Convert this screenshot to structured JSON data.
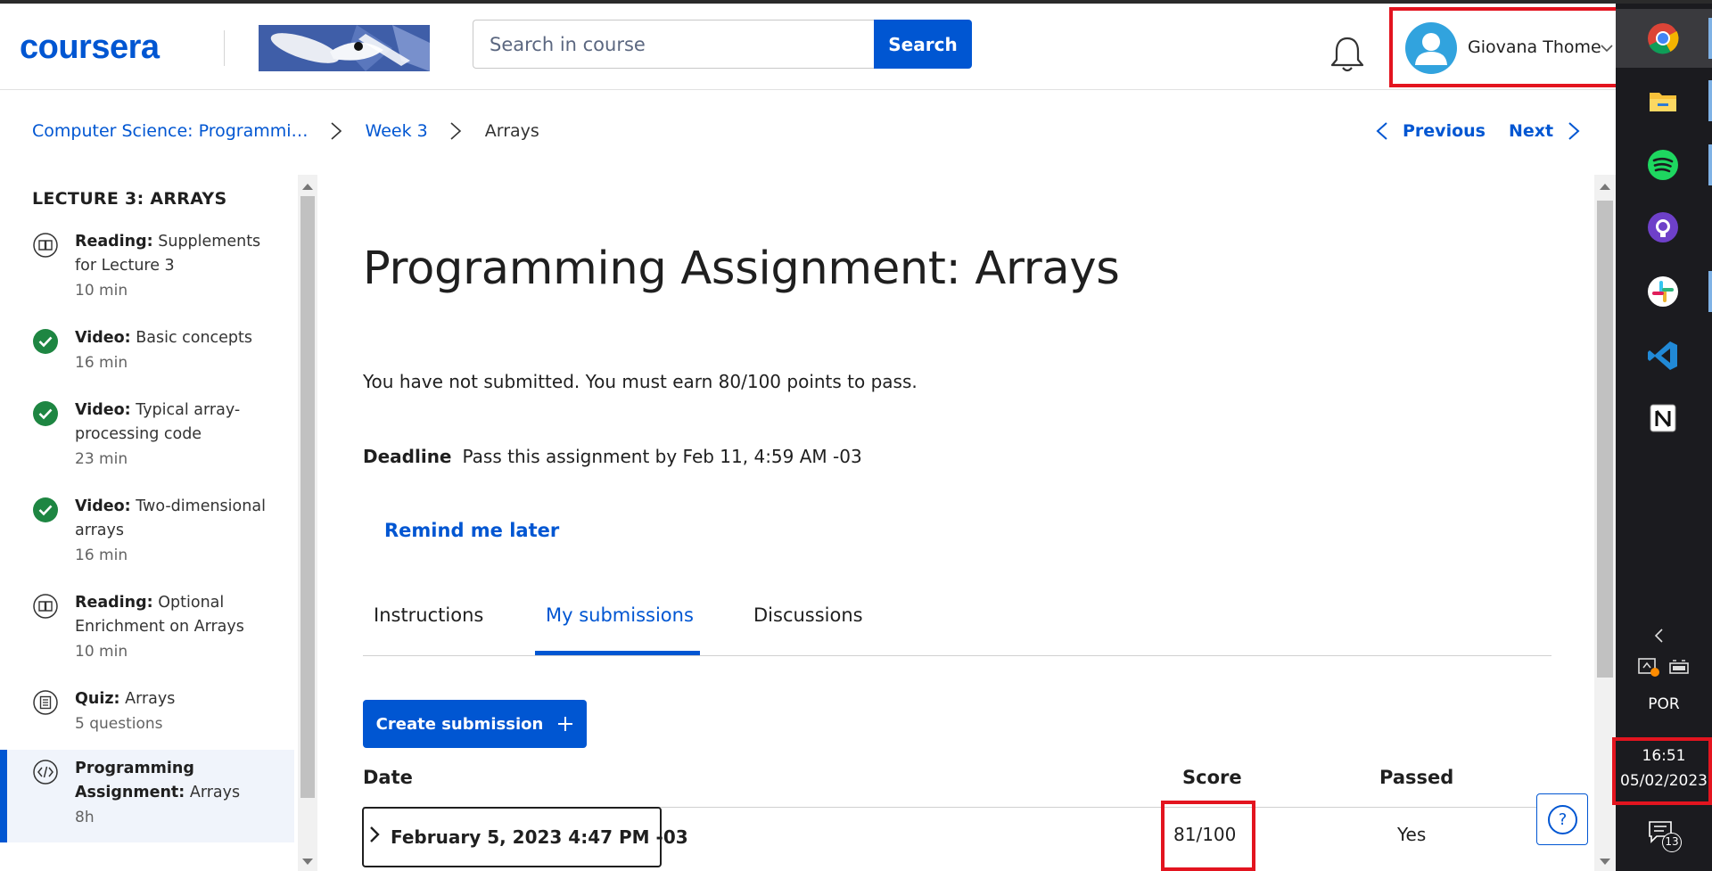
{
  "header": {
    "logo_text": "coursera",
    "search_placeholder": "Search in course",
    "search_button": "Search",
    "user_name": "Giovana Thome"
  },
  "breadcrumb": {
    "items": [
      "Computer Science: Programmi…",
      "Week 3",
      "Arrays"
    ]
  },
  "pager": {
    "previous": "Previous",
    "next": "Next"
  },
  "sidebar": {
    "title": "LECTURE 3: ARRAYS",
    "items": [
      {
        "type": "Reading:",
        "title": "Supplements for Lecture 3",
        "meta": "10 min",
        "icon": "book-icon",
        "status": "pending"
      },
      {
        "type": "Video:",
        "title": "Basic concepts",
        "meta": "16 min",
        "icon": "check-circle-icon",
        "status": "completed"
      },
      {
        "type": "Video:",
        "title": "Typical array-processing code",
        "meta": "23 min",
        "icon": "check-circle-icon",
        "status": "completed"
      },
      {
        "type": "Video:",
        "title": "Two-dimensional arrays",
        "meta": "16 min",
        "icon": "check-circle-icon",
        "status": "completed"
      },
      {
        "type": "Reading:",
        "title": "Optional Enrichment on Arrays",
        "meta": "10 min",
        "icon": "book-icon",
        "status": "pending"
      },
      {
        "type": "Quiz:",
        "title": "Arrays",
        "meta": "5 questions",
        "icon": "quiz-icon",
        "status": "pending"
      },
      {
        "type": "Programming Assignment:",
        "title": "Arrays",
        "meta": "8h",
        "icon": "code-icon",
        "status": "current"
      }
    ]
  },
  "main": {
    "title": "Programming Assignment: Arrays",
    "status": "You have not submitted. You must earn 80/100 points to pass.",
    "deadline_label": "Deadline",
    "deadline_text": "Pass this assignment by Feb 11, 4:59 AM -03",
    "remind_label": "Remind me later",
    "tabs": [
      "Instructions",
      "My submissions",
      "Discussions"
    ],
    "active_tab": "My submissions",
    "create_button": "Create submission",
    "table": {
      "headers": [
        "Date",
        "Score",
        "Passed"
      ],
      "rows": [
        {
          "date": "February 5, 2023 4:47 PM -03",
          "score": "81/100",
          "passed": "Yes"
        }
      ]
    },
    "help_label": "?"
  },
  "taskbar": {
    "apps": [
      "chrome-icon",
      "file-explorer-icon",
      "spotify-icon",
      "github-desktop-icon",
      "slack-icon",
      "vscode-icon",
      "notion-icon"
    ],
    "language": "POR",
    "time": "16:51",
    "date": "05/02/2023",
    "notifications": "13"
  },
  "colors": {
    "brand_blue": "#0056d2",
    "highlight_red": "#e3141f",
    "success_green": "#1e8642",
    "taskbar_bg": "#1b1b1f"
  }
}
